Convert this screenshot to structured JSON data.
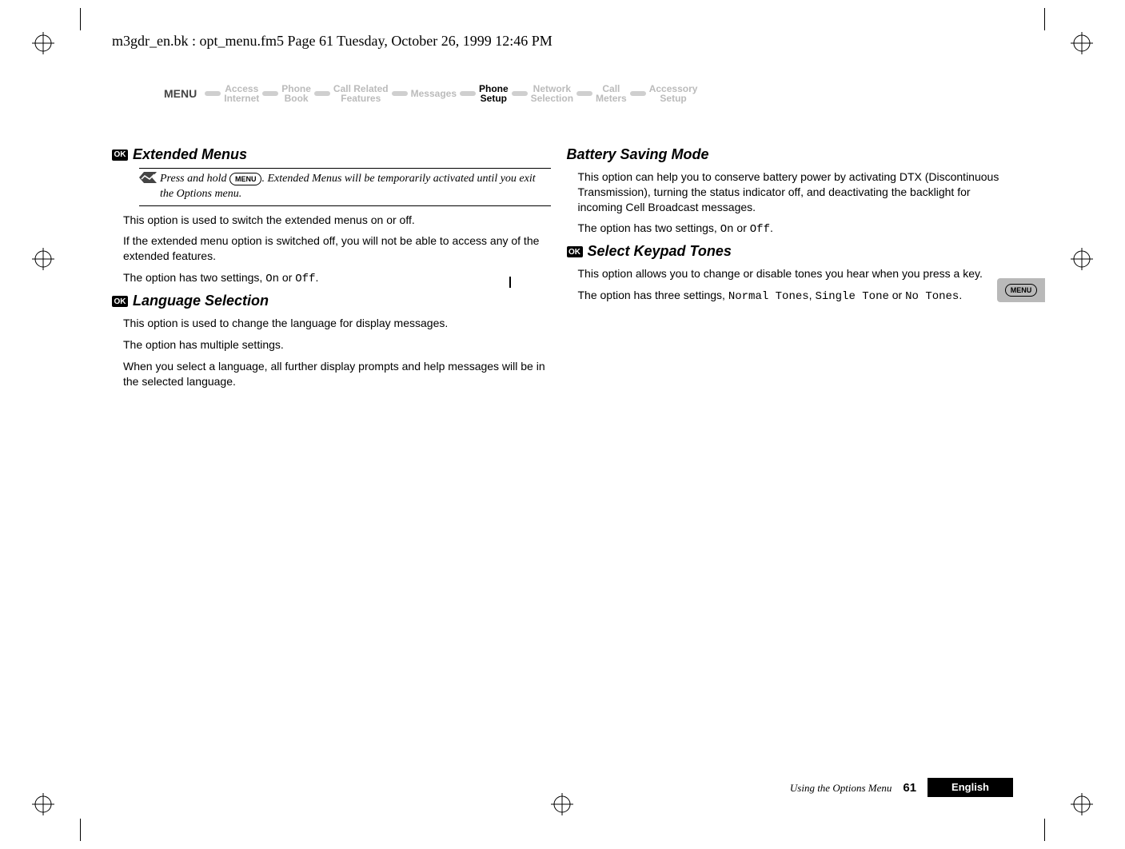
{
  "header_path": "m3gdr_en.bk : opt_menu.fm5  Page 61  Tuesday, October 26, 1999  12:46 PM",
  "nav": {
    "menu_label": "MENU",
    "items": [
      {
        "line1": "Access",
        "line2": "Internet"
      },
      {
        "line1": "Phone",
        "line2": "Book"
      },
      {
        "line1": "Call Related",
        "line2": "Features"
      },
      {
        "line1": "Messages",
        "line2": ""
      },
      {
        "line1": "Phone",
        "line2": "Setup",
        "active": true
      },
      {
        "line1": "Network",
        "line2": "Selection"
      },
      {
        "line1": "Call",
        "line2": "Meters"
      },
      {
        "line1": "Accessory",
        "line2": "Setup"
      }
    ]
  },
  "left": {
    "ext_menus_title": "Extended Menus",
    "ok_label": "OK",
    "tip_prefix": "Press and hold ",
    "tip_key": "MENU",
    "tip_mid": ". Extended Menus will be ",
    "tip_word": "temporarily",
    "tip_suffix": " activated until you exit the Options menu.",
    "p1": "This option is used to switch the extended menus on or off.",
    "p2": "If the extended menu option is switched off, you will not be able to access any of the extended features.",
    "p3_a": "The option has two settings, ",
    "p3_on": "On",
    "p3_or": " or ",
    "p3_off": "Off",
    "p3_end": ".",
    "lang_title": "Language Selection",
    "lp1": "This option is used to change the language for display messages.",
    "lp2": "The option has multiple settings.",
    "lp3": "When you select a language, all further display prompts and help messages will be in the selected language."
  },
  "right": {
    "batt_title": "Battery Saving Mode",
    "bp1": "This option can help you to conserve battery power by activating DTX (Discontinuous Transmission), turning the status indicator off, and deactivating the backlight for incoming Cell Broadcast messages.",
    "bp2_a": "The option has two settings, ",
    "bp2_on": "On",
    "bp2_or": " or ",
    "bp2_off": "Off",
    "bp2_end": ".",
    "keypad_title": "Select Keypad Tones",
    "kp1": "This option allows you to change or disable tones you hear when you press a key.",
    "kp2_a": "The option has three settings, ",
    "kp2_v1": "Normal Tones",
    "kp2_c1": ", ",
    "kp2_v2": "Single Tone",
    "kp2_c2": " or ",
    "kp2_v3": "No Tones",
    "kp2_end": "."
  },
  "side_tab_key": "MENU",
  "footer": {
    "running": "Using the Options Menu",
    "page": "61",
    "language": "English"
  }
}
